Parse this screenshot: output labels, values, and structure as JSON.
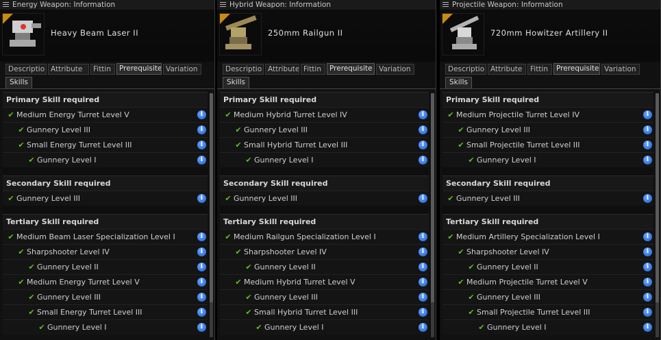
{
  "windows": [
    {
      "title": "Energy Weapon: Information",
      "item": "Heavy Beam Laser II",
      "tabs": [
        "Descriptio",
        "Attribute",
        "Fittin",
        "Prerequisite",
        "Variation"
      ],
      "active_tab": 3,
      "subtab": "Skills",
      "primary_header": "Primary Skill required",
      "secondary_header": "Secondary Skill required",
      "tertiary_header": "Tertiary Skill required",
      "primary": [
        {
          "l": "Medium Energy Turret Level V",
          "i": 0
        },
        {
          "l": "Gunnery Level III",
          "i": 1
        },
        {
          "l": "Small Energy Turret Level III",
          "i": 1
        },
        {
          "l": "Gunnery Level I",
          "i": 2
        }
      ],
      "secondary": [
        {
          "l": "Gunnery Level III",
          "i": 0
        }
      ],
      "tertiary": [
        {
          "l": "Medium Beam Laser Specialization Level I",
          "i": 0
        },
        {
          "l": "Sharpshooter Level IV",
          "i": 1
        },
        {
          "l": "Gunnery Level II",
          "i": 2
        },
        {
          "l": "Medium Energy Turret Level V",
          "i": 1
        },
        {
          "l": "Gunnery Level III",
          "i": 2
        },
        {
          "l": "Small Energy Turret Level III",
          "i": 2
        },
        {
          "l": "Gunnery Level I",
          "i": 3
        }
      ]
    },
    {
      "title": "Hybrid Weapon: Information",
      "item": "250mm Railgun II",
      "tabs": [
        "Descriptio",
        "Attribute",
        "Fittin",
        "Prerequisite",
        "Variation"
      ],
      "active_tab": 3,
      "subtab": "Skills",
      "primary_header": "Primary Skill required",
      "secondary_header": "Secondary Skill required",
      "tertiary_header": "Tertiary Skill required",
      "primary": [
        {
          "l": "Medium Hybrid Turret Level IV",
          "i": 0
        },
        {
          "l": "Gunnery Level III",
          "i": 1
        },
        {
          "l": "Small Hybrid Turret Level III",
          "i": 1
        },
        {
          "l": "Gunnery Level I",
          "i": 2
        }
      ],
      "secondary": [
        {
          "l": "Gunnery Level III",
          "i": 0
        }
      ],
      "tertiary": [
        {
          "l": "Medium Railgun Specialization Level I",
          "i": 0
        },
        {
          "l": "Sharpshooter Level IV",
          "i": 1
        },
        {
          "l": "Gunnery Level II",
          "i": 2
        },
        {
          "l": "Medium Hybrid Turret Level V",
          "i": 1
        },
        {
          "l": "Gunnery Level III",
          "i": 2
        },
        {
          "l": "Small Hybrid Turret Level III",
          "i": 2
        },
        {
          "l": "Gunnery Level I",
          "i": 3
        }
      ]
    },
    {
      "title": "Projectile Weapon: Information",
      "item": "720mm Howitzer Artillery II",
      "tabs": [
        "Descriptio",
        "Attribute",
        "Fittin",
        "Prerequisite",
        "Variation"
      ],
      "active_tab": 3,
      "subtab": "Skills",
      "primary_header": "Primary Skill required",
      "secondary_header": "Secondary Skill required",
      "tertiary_header": "Tertiary Skill required",
      "primary": [
        {
          "l": "Medium Projectile Turret Level IV",
          "i": 0
        },
        {
          "l": "Gunnery Level III",
          "i": 1
        },
        {
          "l": "Small Projectile Turret Level III",
          "i": 1
        },
        {
          "l": "Gunnery Level I",
          "i": 2
        }
      ],
      "secondary": [
        {
          "l": "Gunnery Level III",
          "i": 0
        }
      ],
      "tertiary": [
        {
          "l": "Medium Artillery Specialization Level I",
          "i": 0
        },
        {
          "l": "Sharpshooter Level IV",
          "i": 1
        },
        {
          "l": "Gunnery Level II",
          "i": 2
        },
        {
          "l": "Medium Projectile Turret Level V",
          "i": 1
        },
        {
          "l": "Gunnery Level III",
          "i": 2
        },
        {
          "l": "Small Projectile Turret Level III",
          "i": 2
        },
        {
          "l": "Gunnery Level I",
          "i": 3
        }
      ]
    }
  ],
  "info_glyph": "i",
  "check_glyph": "✔",
  "colors": {
    "check": "#5fbf2a",
    "info": "#2b6fe0",
    "accent": "#c98a14"
  }
}
